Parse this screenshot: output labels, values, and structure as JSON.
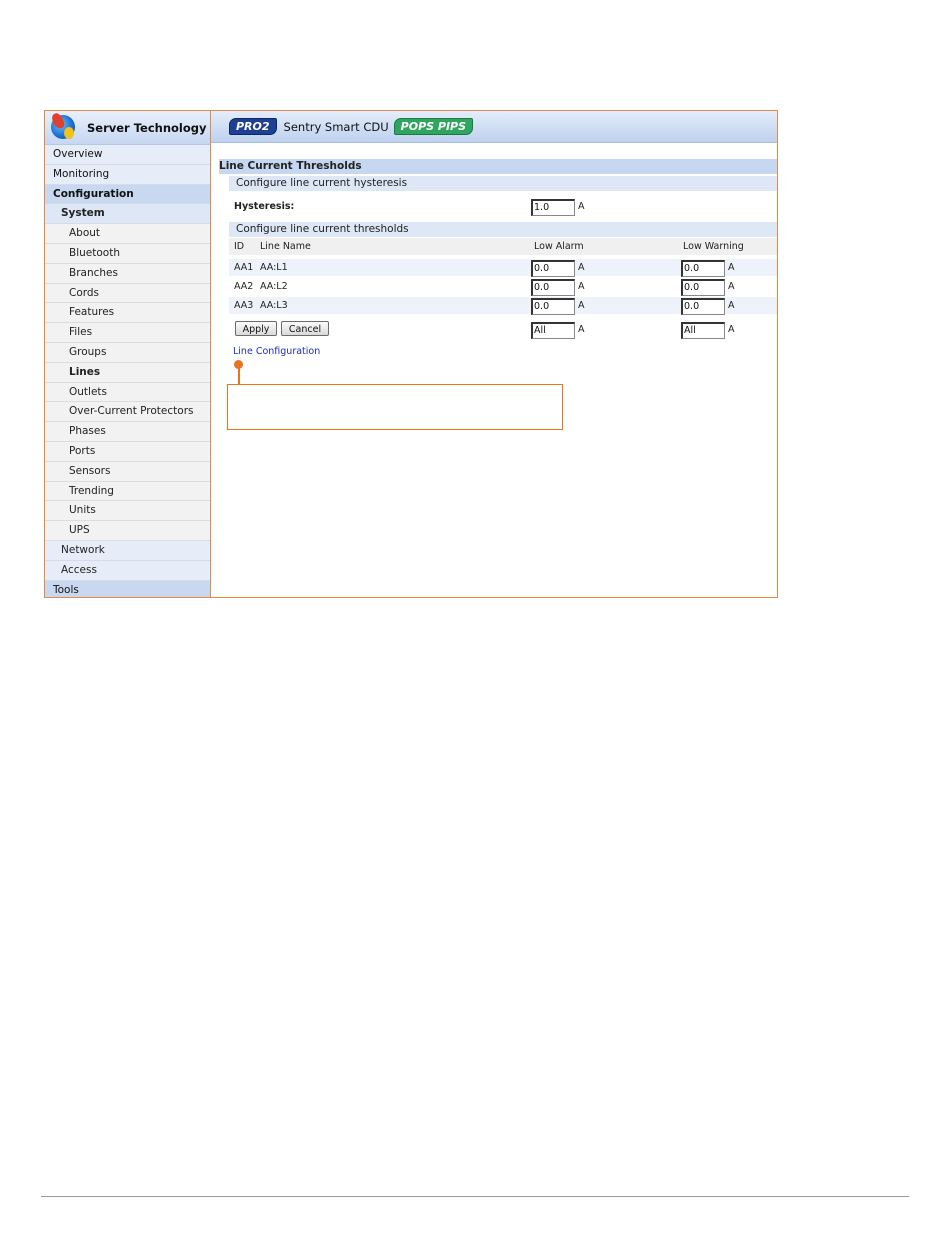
{
  "sidebar": {
    "brand": "Server Technology",
    "items": [
      {
        "label": "Overview",
        "level": 0,
        "active": false
      },
      {
        "label": "Monitoring",
        "level": 0,
        "active": false
      },
      {
        "label": "Configuration",
        "level": 0,
        "active": true
      },
      {
        "label": "System",
        "level": 1,
        "active": true
      },
      {
        "label": "About",
        "level": 2,
        "active": false
      },
      {
        "label": "Bluetooth",
        "level": 2,
        "active": false
      },
      {
        "label": "Branches",
        "level": 2,
        "active": false
      },
      {
        "label": "Cords",
        "level": 2,
        "active": false
      },
      {
        "label": "Features",
        "level": 2,
        "active": false
      },
      {
        "label": "Files",
        "level": 2,
        "active": false
      },
      {
        "label": "Groups",
        "level": 2,
        "active": false
      },
      {
        "label": "Lines",
        "level": 2,
        "active": true
      },
      {
        "label": "Outlets",
        "level": 2,
        "active": false
      },
      {
        "label": "Over-Current Protectors",
        "level": 2,
        "active": false
      },
      {
        "label": "Phases",
        "level": 2,
        "active": false
      },
      {
        "label": "Ports",
        "level": 2,
        "active": false
      },
      {
        "label": "Sensors",
        "level": 2,
        "active": false
      },
      {
        "label": "Trending",
        "level": 2,
        "active": false
      },
      {
        "label": "Units",
        "level": 2,
        "active": false
      },
      {
        "label": "UPS",
        "level": 2,
        "active": false
      },
      {
        "label": "Network",
        "level": 1,
        "active": false
      },
      {
        "label": "Access",
        "level": 1,
        "active": false
      },
      {
        "label": "Tools",
        "level": 0,
        "active": false
      }
    ]
  },
  "header": {
    "badge_left": "PRO2",
    "product": "Sentry Smart CDU",
    "badge_right": "POPS PIPS"
  },
  "main": {
    "title": "Line Current Thresholds",
    "hysteresis_section": "Configure line current hysteresis",
    "hysteresis_label": "Hysteresis:",
    "hysteresis_value": "1.0",
    "unit": "A",
    "thresholds_section": "Configure line current thresholds",
    "columns": {
      "id": "ID",
      "name": "Line Name",
      "low_alarm": "Low Alarm",
      "low_warning": "Low Warning"
    },
    "rows": [
      {
        "id": "AA1",
        "name": "AA:L1",
        "low_alarm": "0.0",
        "low_warning": "0.0"
      },
      {
        "id": "AA2",
        "name": "AA:L2",
        "low_alarm": "0.0",
        "low_warning": "0.0"
      },
      {
        "id": "AA3",
        "name": "AA:L3",
        "low_alarm": "0.0",
        "low_warning": "0.0"
      }
    ],
    "all_low_alarm": "All",
    "all_low_warning": "All",
    "apply_label": "Apply",
    "cancel_label": "Cancel",
    "link_label": "Line Configuration"
  },
  "colors": {
    "frame_border": "#e38a47",
    "callout": "#e8741c",
    "nav_active": "#c9d8f1",
    "link": "#1d2ac7"
  }
}
